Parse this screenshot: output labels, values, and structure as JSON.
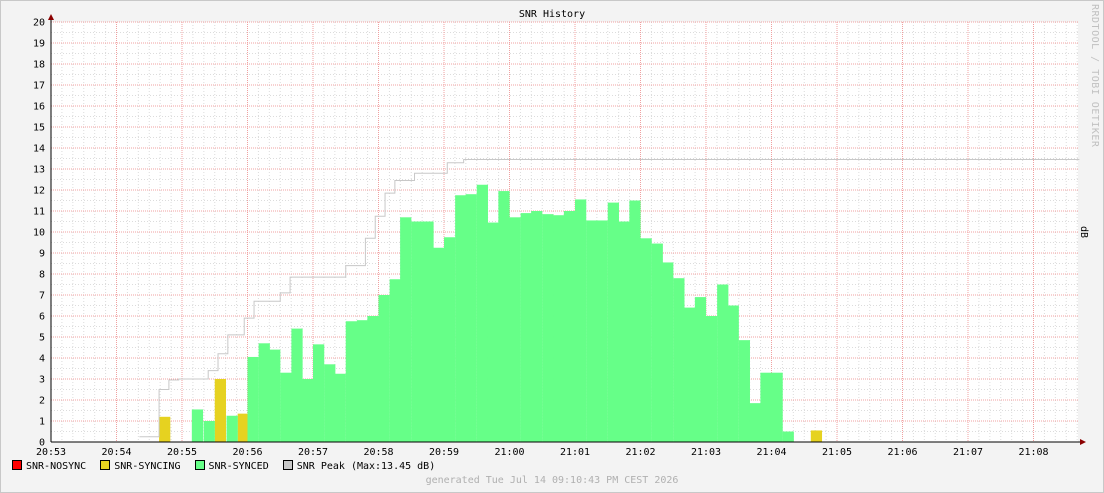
{
  "colors": {
    "nosync": "#ff0000",
    "syncing": "#e6d220",
    "synced": "#66ff88",
    "peak": "#c8c8c8",
    "grid_minor": "#dcdcdc",
    "grid_major": "#f0a0a0",
    "axis": "#8b0000"
  },
  "chart_data": {
    "type": "area",
    "title": "SNR History",
    "xlabel": "",
    "ylabel": "dB",
    "ylim": [
      0,
      20
    ],
    "yticks": [
      0,
      1,
      2,
      3,
      4,
      5,
      6,
      7,
      8,
      9,
      10,
      11,
      12,
      13,
      14,
      15,
      16,
      17,
      18,
      19,
      20
    ],
    "xticks": [
      "20:53",
      "20:54",
      "20:55",
      "20:56",
      "20:57",
      "20:58",
      "20:59",
      "21:00",
      "21:01",
      "21:02",
      "21:03",
      "21:04",
      "21:05",
      "21:06",
      "21:07",
      "21:08"
    ],
    "xlim_minutes": [
      0,
      15.7
    ],
    "bin_minutes": 0.167,
    "grid": true,
    "legend_position": "bottom-left",
    "series": [
      {
        "name": "SNR-NOSYNC",
        "bins": []
      },
      {
        "name": "SNR-SYNCING",
        "bins": [
          [
            1.65,
            1.2
          ],
          [
            2.5,
            3.0
          ],
          [
            2.85,
            1.35
          ],
          [
            11.6,
            0.55
          ]
        ]
      },
      {
        "name": "SNR-SYNCED",
        "bins": [
          [
            2.15,
            1.55
          ],
          [
            2.33,
            1.0
          ],
          [
            2.68,
            1.25
          ],
          [
            3.0,
            4.05
          ],
          [
            3.17,
            4.7
          ],
          [
            3.33,
            4.4
          ],
          [
            3.5,
            3.3
          ],
          [
            3.67,
            5.4
          ],
          [
            3.83,
            3.0
          ],
          [
            4.0,
            4.65
          ],
          [
            4.17,
            3.7
          ],
          [
            4.33,
            3.25
          ],
          [
            4.5,
            5.75
          ],
          [
            4.67,
            5.8
          ],
          [
            4.83,
            6.0
          ],
          [
            5.0,
            7.0
          ],
          [
            5.17,
            7.75
          ],
          [
            5.33,
            10.7
          ],
          [
            5.5,
            10.5
          ],
          [
            5.67,
            10.5
          ],
          [
            5.83,
            9.25
          ],
          [
            6.0,
            9.75
          ],
          [
            6.17,
            11.75
          ],
          [
            6.33,
            11.8
          ],
          [
            6.5,
            12.25
          ],
          [
            6.67,
            10.45
          ],
          [
            6.83,
            11.95
          ],
          [
            7.0,
            10.7
          ],
          [
            7.17,
            10.9
          ],
          [
            7.33,
            11.0
          ],
          [
            7.5,
            10.85
          ],
          [
            7.67,
            10.8
          ],
          [
            7.83,
            11.0
          ],
          [
            8.0,
            11.55
          ],
          [
            8.17,
            10.55
          ],
          [
            8.33,
            10.55
          ],
          [
            8.5,
            11.4
          ],
          [
            8.67,
            10.5
          ],
          [
            8.83,
            11.5
          ],
          [
            9.0,
            9.7
          ],
          [
            9.17,
            9.45
          ],
          [
            9.33,
            8.55
          ],
          [
            9.5,
            7.8
          ],
          [
            9.67,
            6.4
          ],
          [
            9.83,
            6.9
          ],
          [
            10.0,
            6.0
          ],
          [
            10.17,
            7.5
          ],
          [
            10.33,
            6.5
          ],
          [
            10.5,
            4.85
          ],
          [
            10.67,
            1.85
          ],
          [
            10.83,
            3.3
          ],
          [
            11.0,
            3.3
          ],
          [
            11.17,
            0.5
          ]
        ]
      },
      {
        "name": "SNR Peak",
        "steps": [
          [
            1.35,
            0.25
          ],
          [
            1.65,
            2.5
          ],
          [
            1.8,
            2.95
          ],
          [
            1.95,
            3.0
          ],
          [
            2.4,
            3.4
          ],
          [
            2.55,
            4.2
          ],
          [
            2.7,
            5.1
          ],
          [
            2.95,
            5.9
          ],
          [
            3.1,
            6.7
          ],
          [
            3.5,
            7.1
          ],
          [
            3.65,
            7.85
          ],
          [
            4.5,
            8.4
          ],
          [
            4.8,
            9.7
          ],
          [
            4.95,
            10.75
          ],
          [
            5.1,
            11.85
          ],
          [
            5.25,
            12.45
          ],
          [
            5.55,
            12.8
          ],
          [
            6.05,
            13.3
          ],
          [
            6.3,
            13.45
          ],
          [
            15.7,
            13.45
          ]
        ]
      }
    ],
    "legend": [
      "SNR-NOSYNC",
      "SNR-SYNCING",
      "SNR-SYNCED",
      "SNR Peak"
    ],
    "annotation": "(Max:13.45 dB)"
  },
  "side_text": "RRDTOOL / TOBI OETIKER",
  "footer": "generated Tue Jul 14 09:10:43 PM CEST 2026"
}
